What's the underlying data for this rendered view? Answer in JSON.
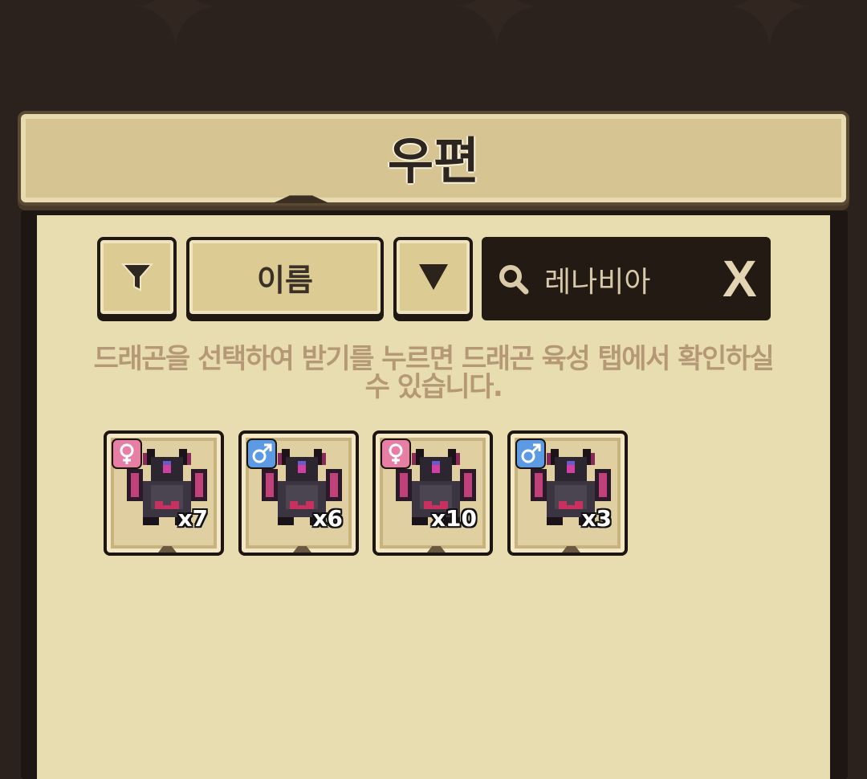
{
  "header": {
    "title": "우편"
  },
  "toolbar": {
    "filter_icon": "funnel-icon",
    "sort_label": "이름",
    "order_icon": "triangle-down-icon"
  },
  "search": {
    "value": "레나비아",
    "clear_label": "X",
    "icon": "search-icon"
  },
  "hint": {
    "line1": "드래곤을 선택하여 받기를 누르면 드래곤 육성 탭에서 확인하실",
    "line2": "수 있습니다."
  },
  "items": [
    {
      "gender": "female",
      "count": "x7"
    },
    {
      "gender": "male",
      "count": "x6"
    },
    {
      "gender": "female",
      "count": "x10"
    },
    {
      "gender": "male",
      "count": "x3"
    }
  ],
  "colors": {
    "background": "#2b211d",
    "panel": "#e8ddb1",
    "button": "#dccb93",
    "hint_text": "#b59875",
    "female_badge": "#e77fa4",
    "male_badge": "#5c9ae4"
  }
}
